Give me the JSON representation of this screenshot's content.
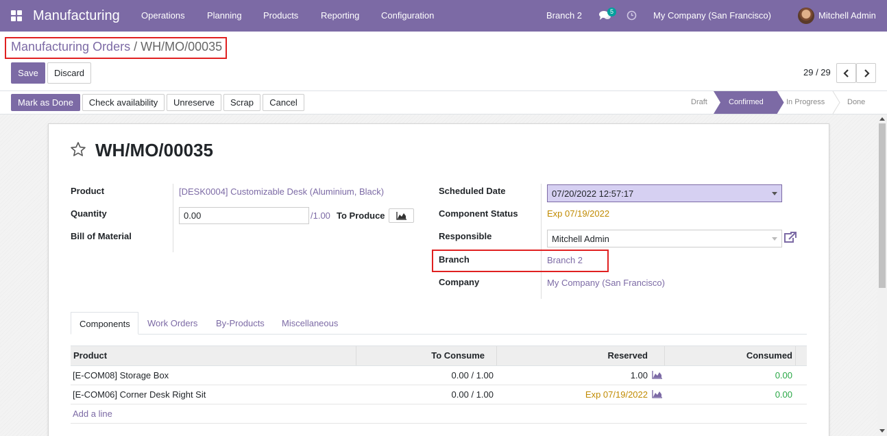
{
  "navbar": {
    "app_title": "Manufacturing",
    "menu": [
      "Operations",
      "Planning",
      "Products",
      "Reporting",
      "Configuration"
    ],
    "branch": "Branch 2",
    "messages_count": "5",
    "company": "My Company (San Francisco)",
    "user": "Mitchell Admin"
  },
  "breadcrumb": {
    "parent": "Manufacturing Orders",
    "separator": "/",
    "current": "WH/MO/00035"
  },
  "actions": {
    "save": "Save",
    "discard": "Discard",
    "pager": "29 / 29"
  },
  "statusbar": {
    "buttons": [
      "Mark as Done",
      "Check availability",
      "Unreserve",
      "Scrap",
      "Cancel"
    ],
    "stages": [
      "Draft",
      "Confirmed",
      "In Progress",
      "Done"
    ],
    "active_stage": "Confirmed"
  },
  "record": {
    "name": "WH/MO/00035",
    "product_label": "Product",
    "product_value": "[DESK0004] Customizable Desk (Aluminium, Black)",
    "quantity_label": "Quantity",
    "quantity_value": "0.00",
    "quantity_total": "/1.00",
    "to_produce_label": "To Produce",
    "bom_label": "Bill of Material",
    "scheduled_date_label": "Scheduled Date",
    "scheduled_date_value": "07/20/2022 12:57:17",
    "component_status_label": "Component Status",
    "component_status_value": "Exp 07/19/2022",
    "responsible_label": "Responsible",
    "responsible_value": "Mitchell Admin",
    "branch_label": "Branch",
    "branch_value": "Branch 2",
    "company_label": "Company",
    "company_value": "My Company (San Francisco)"
  },
  "tabs": [
    "Components",
    "Work Orders",
    "By-Products",
    "Miscellaneous"
  ],
  "components_table": {
    "headers": [
      "Product",
      "To Consume",
      "Reserved",
      "Consumed"
    ],
    "rows": [
      {
        "product": "[E-COM08] Storage Box",
        "to_consume": "0.00 / 1.00",
        "reserved": "1.00",
        "consumed": "0.00"
      },
      {
        "product": "[E-COM06] Corner Desk Right Sit",
        "to_consume": "0.00 / 1.00",
        "reserved": "Exp 07/19/2022",
        "consumed": "0.00"
      }
    ],
    "add_line": "Add a line"
  },
  "colors": {
    "brand": "#7c6aa5",
    "warning": "#c08a00",
    "success": "#28a745",
    "highlight": "#e02020"
  }
}
